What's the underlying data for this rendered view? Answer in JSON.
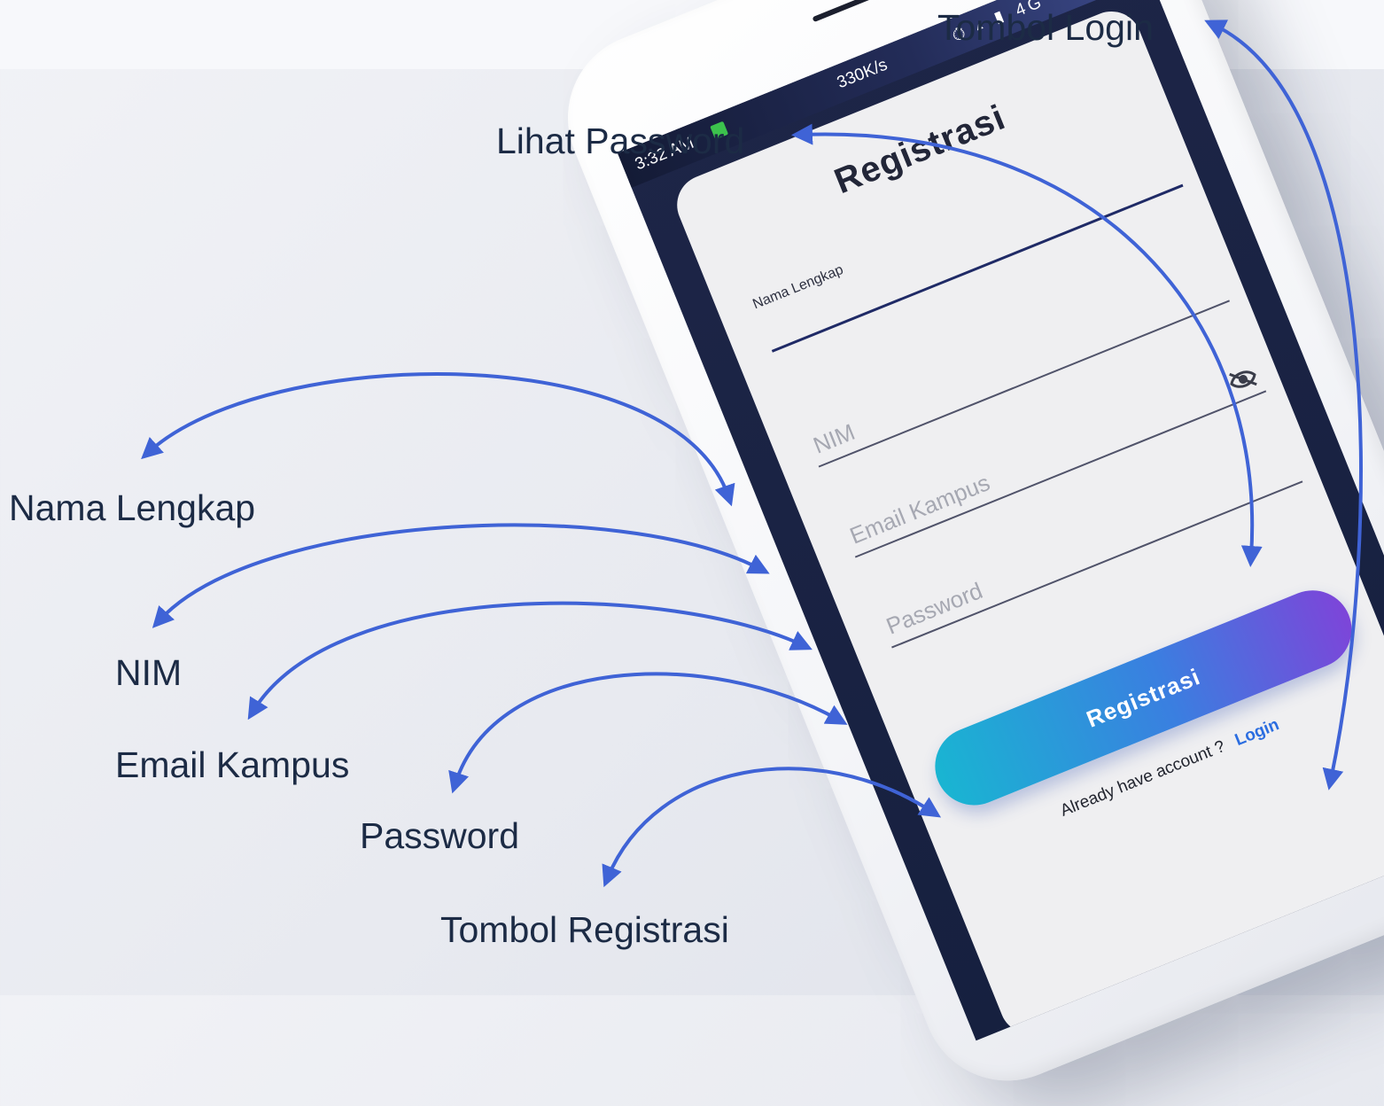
{
  "annotations": {
    "tombol_login": "Tombol Login",
    "lihat_password": "Lihat Password",
    "nama_lengkap": "Nama Lengkap",
    "nim": "NIM",
    "email_kampus": "Email Kampus",
    "password": "Password",
    "tombol_registrasi": "Tombol Registrasi"
  },
  "status_bar": {
    "time": "3:32 AM",
    "speed": "330K/s",
    "icons": "⏱ ▴ ▮ 4G"
  },
  "form": {
    "title": "Registrasi",
    "fields": {
      "nama_lengkap_label": "Nama Lengkap",
      "nim_placeholder": "NIM",
      "email_placeholder": "Email Kampus",
      "password_placeholder": "Password"
    },
    "submit_label": "Registrasi",
    "account_prompt": "Already have account ?",
    "login_link": "Login"
  },
  "colors": {
    "arrow": "#3f63d6",
    "annotation_text": "#1c2b45",
    "button_gradient": [
      "#19b5d2",
      "#3a7fe0",
      "#7d45d9"
    ],
    "screen_background": "#1d2547",
    "card_background": "#efeff1",
    "link": "#2b6de0"
  }
}
